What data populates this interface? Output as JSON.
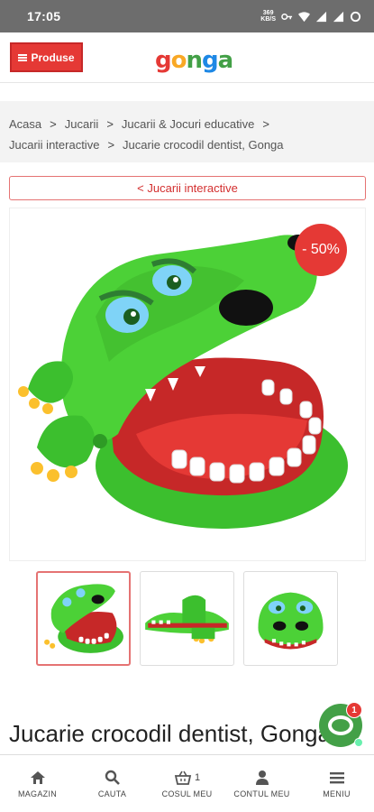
{
  "status_bar": {
    "time": "17:05",
    "data_rate": "369",
    "data_unit": "KB/S"
  },
  "header": {
    "menu_label": "Produse",
    "logo_text": "gonga"
  },
  "breadcrumb": {
    "items": [
      "Acasa",
      "Jucarii",
      "Jucarii & Jocuri educative",
      "Jucarii interactive",
      "Jucarie crocodil dentist, Gonga"
    ]
  },
  "back_link": "< Jucarii interactive",
  "product": {
    "discount": "- 50%",
    "title": "Jucarie crocodil dentist, Gonga",
    "thumbnails": [
      "front-view",
      "side-view",
      "face-view"
    ]
  },
  "chat": {
    "unread_count": "1"
  },
  "bottom_nav": {
    "items": [
      {
        "label": "MAGAZIN",
        "icon": "home-icon"
      },
      {
        "label": "CAUTA",
        "icon": "search-icon"
      },
      {
        "label": "COSUL MEU",
        "icon": "cart-icon",
        "count": "1"
      },
      {
        "label": "CONTUL MEU",
        "icon": "user-icon"
      },
      {
        "label": "MENIU",
        "icon": "menu-icon"
      }
    ]
  },
  "colors": {
    "accent": "#e53935",
    "croc_green": "#4cd137",
    "mouth_red": "#c62828",
    "chat_green": "#43a047"
  }
}
